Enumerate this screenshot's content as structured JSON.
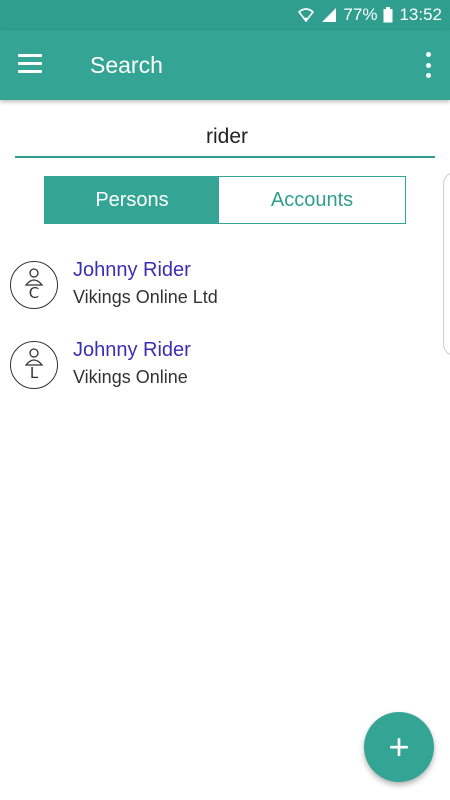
{
  "status_bar": {
    "battery": "77%",
    "time": "13:52",
    "icons": [
      "wifi-icon",
      "signal-icon",
      "battery-icon"
    ]
  },
  "toolbar": {
    "title": "Search",
    "menu_icon": "hamburger-menu-icon",
    "overflow_icon": "overflow-menu-icon"
  },
  "search": {
    "value": "rider"
  },
  "tabs": [
    {
      "label": "Persons",
      "active": true
    },
    {
      "label": "Accounts",
      "active": false
    }
  ],
  "results": [
    {
      "name": "Johnny Rider",
      "company": "Vikings Online Ltd",
      "avatar_letter": "C"
    },
    {
      "name": "Johnny Rider",
      "company": "Vikings Online",
      "avatar_letter": "L"
    }
  ],
  "fab": {
    "label": "+"
  },
  "colors": {
    "primary": "#34a594",
    "primary_dark": "#2f9e8e",
    "link": "#3a2fb3"
  }
}
